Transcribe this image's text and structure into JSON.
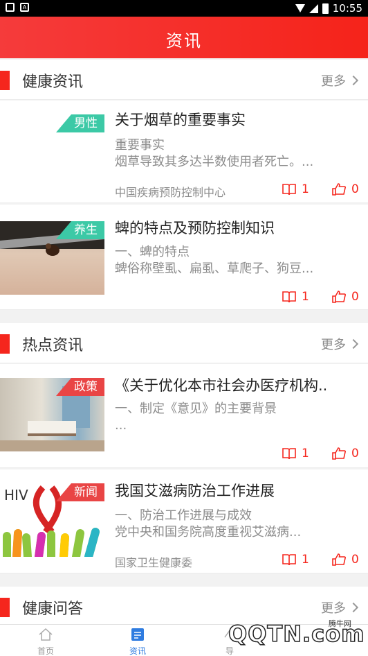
{
  "status_bar": {
    "time": "10:55"
  },
  "header": {
    "title": "资讯"
  },
  "sections": {
    "health_news": {
      "title": "健康资讯",
      "more": "更多"
    },
    "hot_news": {
      "title": "热点资讯",
      "more": "更多"
    },
    "health_qa": {
      "title": "健康问答",
      "more": "更多"
    }
  },
  "articles": [
    {
      "tag": "男性",
      "title": "关于烟草的重要事实",
      "desc": "重要事实\n烟草导致其多达半数使用者死亡。...",
      "source": "中国疾病预防控制中心",
      "reads": "1",
      "likes": "0"
    },
    {
      "tag": "养生",
      "title": "蜱的特点及预防控制知识",
      "desc": "一、蜱的特点\n蜱俗称壁虱、扁虱、草爬子、狗豆...",
      "source": "",
      "reads": "1",
      "likes": "0"
    },
    {
      "tag": "政策",
      "title": "《关于优化本市社会办医疗机构..",
      "desc": "一、制定《意见》的主要背景\n...",
      "source": "",
      "reads": "1",
      "likes": "0"
    },
    {
      "tag": "新闻",
      "title": "我国艾滋病防治工作进展",
      "desc": "一、防治工作进展与成效\n    党中央和国务院高度重视艾滋病...",
      "source": "国家卫生健康委",
      "reads": "1",
      "likes": "0"
    }
  ],
  "image_text": {
    "hiv": "HIV"
  },
  "tabbar": {
    "home": "首页",
    "news": "资讯",
    "guide": "导"
  },
  "watermark": "QQTN.com",
  "watermark_small": "腾牛网"
}
